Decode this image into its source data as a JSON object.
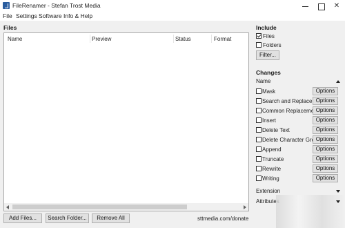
{
  "window": {
    "title": "FileRenamer - Stefan Trost Media"
  },
  "menu": [
    "File",
    "Settings",
    "Software",
    "Info & Help"
  ],
  "files": {
    "title": "Files",
    "columns": [
      "Name",
      "Preview",
      "Status",
      "Format"
    ]
  },
  "buttons": {
    "add": "Add Files...",
    "search": "Search Folder...",
    "remove": "Remove All"
  },
  "donate": "sttmedia.com/donate",
  "include": {
    "title": "Include",
    "files_label": "Files",
    "files_checked": true,
    "folders_label": "Folders",
    "folders_checked": false,
    "filter_label": "Filter..."
  },
  "changes": {
    "title": "Changes",
    "name_label": "Name",
    "options_label": "Options",
    "items": [
      "Mask",
      "Search and Replace",
      "Common Replacements",
      "Insert",
      "Delete Text",
      "Delete Character Groups",
      "Append",
      "Truncate",
      "Rewrite",
      "Writing"
    ],
    "extension_label": "Extension",
    "attributes_label": "Attributes"
  }
}
